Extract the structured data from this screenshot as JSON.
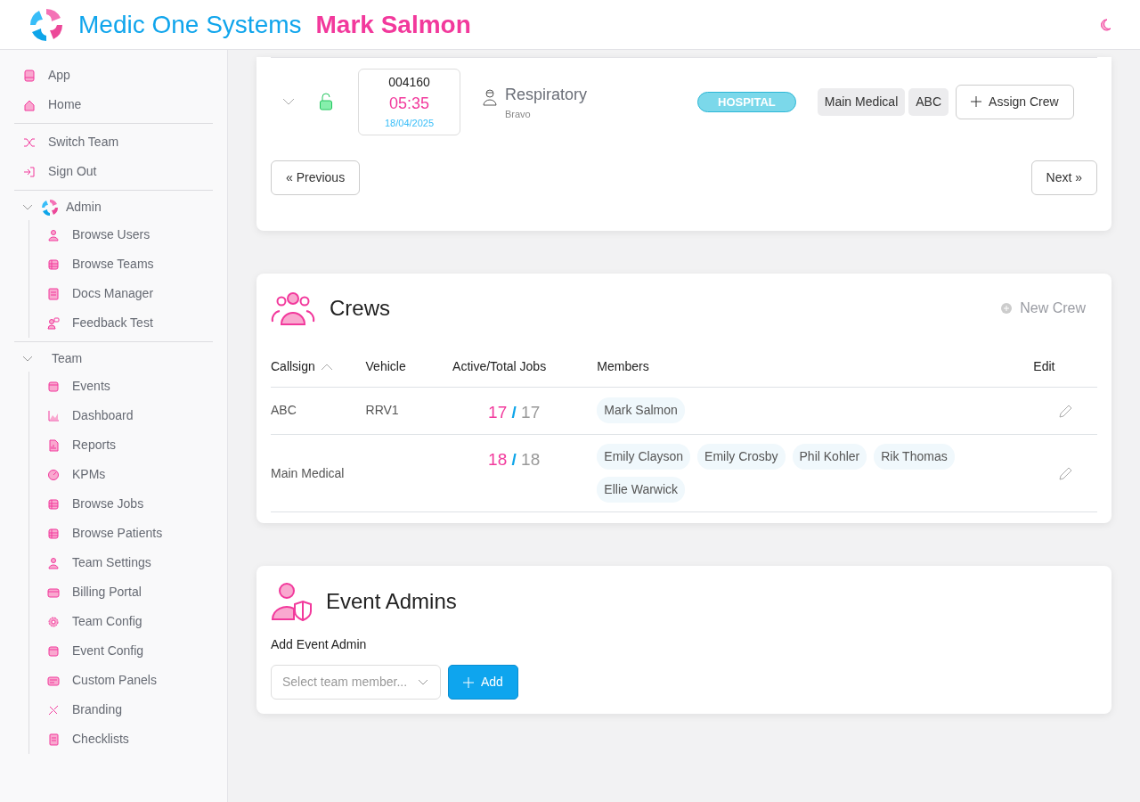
{
  "header": {
    "brand": "Medic One Systems",
    "user": "Mark Salmon"
  },
  "sidebar": {
    "blocks": [
      {
        "kind": "links",
        "items": [
          {
            "label": "App"
          },
          {
            "label": "Home"
          }
        ]
      },
      {
        "kind": "links",
        "items": [
          {
            "label": "Switch Team"
          },
          {
            "label": "Sign Out"
          }
        ]
      },
      {
        "kind": "section",
        "label": "Admin",
        "expanded": true,
        "logo": true,
        "children": [
          {
            "label": "Browse Users"
          },
          {
            "label": "Browse Teams"
          },
          {
            "label": "Docs Manager"
          },
          {
            "label": "Feedback Test"
          }
        ]
      },
      {
        "kind": "section",
        "label": "Team",
        "expanded": true,
        "logo": false,
        "children": [
          {
            "label": "Events"
          },
          {
            "label": "Dashboard"
          },
          {
            "label": "Reports"
          },
          {
            "label": "KPMs"
          },
          {
            "label": "Browse Jobs"
          },
          {
            "label": "Browse Patients"
          },
          {
            "label": "Team Settings"
          },
          {
            "label": "Billing Portal"
          },
          {
            "label": "Team Config"
          },
          {
            "label": "Event Config"
          },
          {
            "label": "Custom Panels"
          },
          {
            "label": "Branding"
          },
          {
            "label": "Checklists"
          }
        ]
      }
    ]
  },
  "jobs": {
    "rows": [
      {
        "expanded": false,
        "locked": false,
        "number": "004160",
        "time": "05:35",
        "date": "18/04/2025",
        "type": "Respiratory",
        "subtitle": "Bravo",
        "status": "HOSPITAL",
        "crews": [
          "Main Medical",
          "ABC"
        ],
        "assign": "Assign Crew"
      }
    ],
    "previous": "« Previous",
    "next": "Next »"
  },
  "crews": {
    "title": "Crews",
    "new_button": "New Crew",
    "columns": [
      {
        "label": "Callsign",
        "sorted": true
      },
      {
        "label": "Vehicle",
        "sorted": false
      },
      {
        "label": "Active/Total Jobs",
        "sorted": false
      },
      {
        "label": "Members",
        "sorted": false
      },
      {
        "label": "Edit",
        "sorted": false
      }
    ],
    "rows": [
      {
        "callsign": "ABC",
        "vehicle": "RRV1",
        "active": "17",
        "separator": "/",
        "total": "17",
        "members": [
          "Mark Salmon"
        ]
      },
      {
        "callsign": "Main Medical",
        "active": "18",
        "separator": "/",
        "total": "18",
        "members": [
          "Emily Clayson",
          "Emily Crosby",
          "Phil Kohler",
          "Rik Thomas",
          "Ellie Warwick"
        ]
      }
    ]
  },
  "event_admins": {
    "title": "Event Admins",
    "label": "Add Event Admin",
    "placeholder": "Select team member...",
    "add_button": "Add"
  }
}
